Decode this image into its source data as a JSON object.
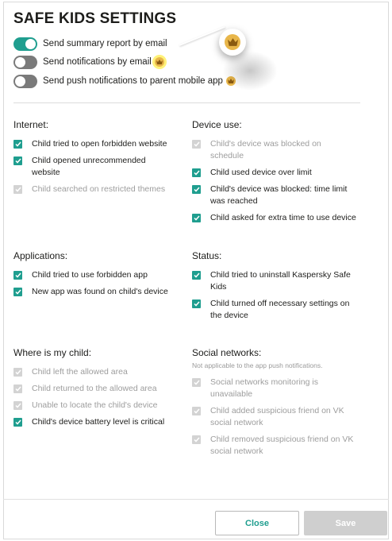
{
  "title": "SAFE KIDS SETTINGS",
  "toggles": [
    {
      "label": "Send summary report by email",
      "on": true,
      "premium": false
    },
    {
      "label": "Send notifications by email",
      "on": false,
      "premium": true
    },
    {
      "label": "Send push notifications to parent mobile app",
      "on": false,
      "premium": true
    }
  ],
  "accent_color": "#1f9e8f",
  "premium_icon": "crown-icon",
  "sections": {
    "internet": {
      "title": "Internet:",
      "items": [
        {
          "label": "Child tried to open forbidden website",
          "checked": true,
          "disabled": false
        },
        {
          "label": "Child opened unrecommended website",
          "checked": true,
          "disabled": false
        },
        {
          "label": "Child searched on restricted themes",
          "checked": true,
          "disabled": true
        }
      ]
    },
    "device_use": {
      "title": "Device use:",
      "items": [
        {
          "label": "Child's device was blocked on schedule",
          "checked": true,
          "disabled": true
        },
        {
          "label": "Child used device over limit",
          "checked": true,
          "disabled": false
        },
        {
          "label": "Child's device was blocked: time limit was reached",
          "checked": true,
          "disabled": false
        },
        {
          "label": "Child asked for extra time to use device",
          "checked": true,
          "disabled": false
        }
      ]
    },
    "applications": {
      "title": "Applications:",
      "items": [
        {
          "label": "Child tried to use forbidden app",
          "checked": true,
          "disabled": false
        },
        {
          "label": "New app was found on child's device",
          "checked": true,
          "disabled": false
        }
      ]
    },
    "status": {
      "title": "Status:",
      "items": [
        {
          "label": "Child tried to uninstall Kaspersky Safe Kids",
          "checked": true,
          "disabled": false
        },
        {
          "label": "Child turned off necessary settings on the device",
          "checked": true,
          "disabled": false
        }
      ]
    },
    "where": {
      "title": "Where is my child:",
      "items": [
        {
          "label": "Child left the allowed area",
          "checked": true,
          "disabled": true
        },
        {
          "label": "Child returned to the allowed area",
          "checked": true,
          "disabled": true
        },
        {
          "label": "Unable to locate the child's device",
          "checked": true,
          "disabled": true
        },
        {
          "label": "Child's device battery level is critical",
          "checked": true,
          "disabled": false
        }
      ]
    },
    "social": {
      "title": "Social networks:",
      "note": "Not applicable to the app push notifications.",
      "items": [
        {
          "label": "Social networks monitoring is unavailable",
          "checked": true,
          "disabled": true
        },
        {
          "label": "Child added suspicious friend on VK social network",
          "checked": true,
          "disabled": true
        },
        {
          "label": "Child removed suspicious friend on VK social network",
          "checked": true,
          "disabled": true
        }
      ]
    }
  },
  "buttons": {
    "close": "Close",
    "save": "Save"
  }
}
